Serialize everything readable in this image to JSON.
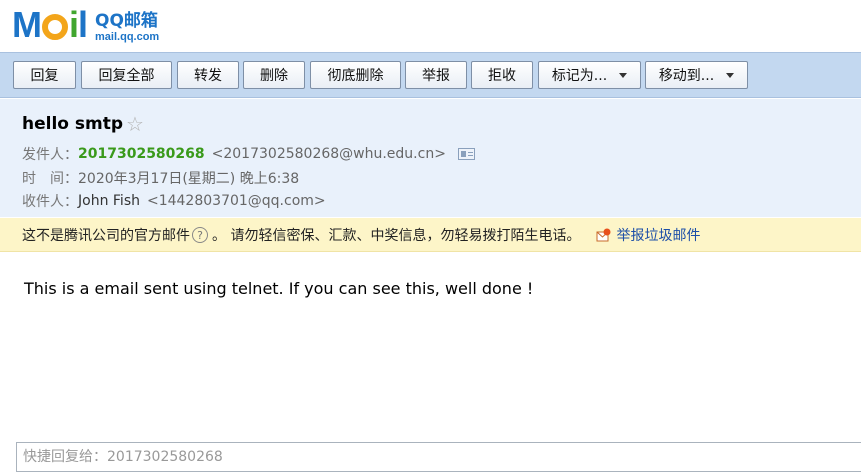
{
  "logo": {
    "wordmark": {
      "m": "M",
      "i": "i",
      "l": "l"
    },
    "name": "QQ邮箱",
    "domain": "mail.qq.com"
  },
  "toolbar": {
    "reply": "回复",
    "reply_all": "回复全部",
    "forward": "转发",
    "delete": "删除",
    "delete_permanently": "彻底删除",
    "report": "举报",
    "reject": "拒收",
    "mark_as": "标记为...",
    "move_to": "移动到..."
  },
  "email": {
    "subject": "hello smtp",
    "star": "☆",
    "from_label": "发件人：",
    "from_name": "2017302580268",
    "from_address": "<2017302580268@whu.edu.cn>",
    "time_label": "时　间：",
    "time_value": "2020年3月17日(星期二) 晚上6:38",
    "to_label": "收件人：",
    "to_name": "John Fish",
    "to_address": "<1442803701@qq.com>",
    "body": "This is a email sent using telnet. If you can see this, well done !"
  },
  "warning": {
    "text": "这不是腾讯公司的官方邮件",
    "help": "?",
    "advice": "。  请勿轻信密保、汇款、中奖信息，勿轻易拨打陌生电话。",
    "report_link": "举报垃圾邮件"
  },
  "quick_reply": {
    "placeholder": "快捷回复给：2017302580268"
  },
  "colors": {
    "toolbar_bg": "#c3d8f0",
    "header_bg": "#e9f1fb",
    "warning_bg": "#fdf5c8",
    "sender_green": "#3a9a1b",
    "link_blue": "#1c4ea8"
  }
}
